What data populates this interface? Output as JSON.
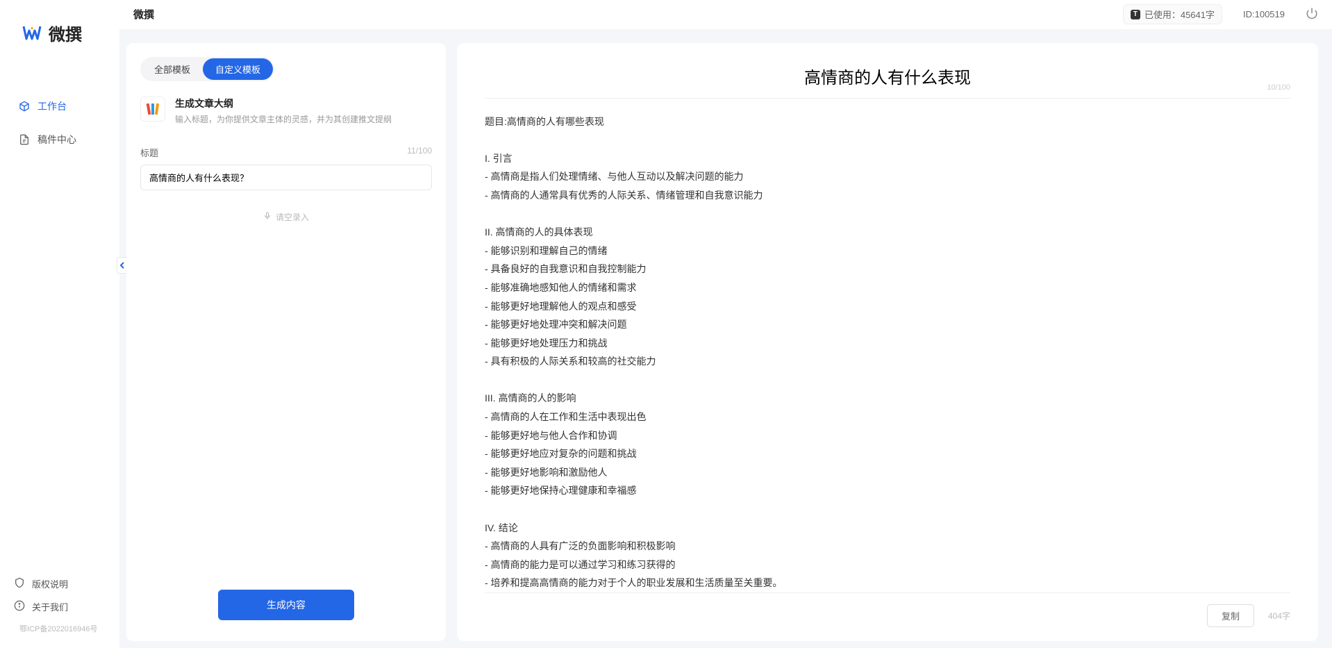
{
  "app": {
    "logoText": "微撰",
    "topTitle": "微撰",
    "usageLabel": "已使用：45641字",
    "userId": "ID:100519"
  },
  "sidebar": {
    "nav": [
      {
        "label": "工作台",
        "active": true
      },
      {
        "label": "稿件中心",
        "active": false
      }
    ],
    "bottom": [
      {
        "label": "版权说明"
      },
      {
        "label": "关于我们"
      }
    ],
    "icp": "鄂ICP备2022016946号"
  },
  "left": {
    "tabs": [
      {
        "label": "全部模板",
        "active": false
      },
      {
        "label": "自定义模板",
        "active": true
      }
    ],
    "card": {
      "title": "生成文章大纲",
      "desc": "输入标题，为你提供文章主体的灵感，并为其创建推文提纲"
    },
    "field": {
      "label": "标题",
      "counter": "11/100",
      "value": "高情商的人有什么表现？"
    },
    "voicePlaceholder": "请空录入",
    "generateLabel": "生成内容"
  },
  "right": {
    "title": "高情商的人有什么表现",
    "titleCounter": "10/100",
    "body": "题目:高情商的人有哪些表现\n\nI. 引言\n- 高情商是指人们处理情绪、与他人互动以及解决问题的能力\n- 高情商的人通常具有优秀的人际关系、情绪管理和自我意识能力\n\nII. 高情商的人的具体表现\n- 能够识别和理解自己的情绪\n- 具备良好的自我意识和自我控制能力\n- 能够准确地感知他人的情绪和需求\n- 能够更好地理解他人的观点和感受\n- 能够更好地处理冲突和解决问题\n- 能够更好地处理压力和挑战\n- 具有积极的人际关系和较高的社交能力\n\nIII. 高情商的人的影响\n- 高情商的人在工作和生活中表现出色\n- 能够更好地与他人合作和协调\n- 能够更好地应对复杂的问题和挑战\n- 能够更好地影响和激励他人\n- 能够更好地保持心理健康和幸福感\n\nIV. 结论\n- 高情商的人具有广泛的负面影响和积极影响\n- 高情商的能力是可以通过学习和练习获得的\n- 培养和提高高情商的能力对于个人的职业发展和生活质量至关重要。",
    "copyLabel": "复制",
    "wordCount": "404字"
  }
}
